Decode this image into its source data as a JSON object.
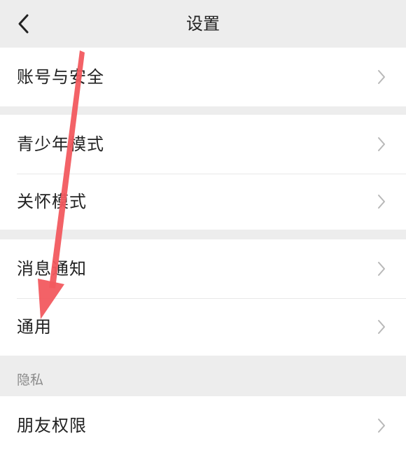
{
  "header": {
    "title": "设置",
    "back_icon": "chevron-left-icon"
  },
  "groups": [
    {
      "items": [
        {
          "label": "账号与安全"
        }
      ]
    },
    {
      "items": [
        {
          "label": "青少年模式"
        },
        {
          "label": "关怀模式"
        }
      ]
    },
    {
      "items": [
        {
          "label": "消息通知"
        },
        {
          "label": "通用"
        }
      ]
    },
    {
      "title": "隐私",
      "items": [
        {
          "label": "朋友权限"
        }
      ]
    }
  ],
  "colors": {
    "background": "#ededed",
    "card": "#ffffff",
    "annotation_arrow": "#f25a5f"
  }
}
